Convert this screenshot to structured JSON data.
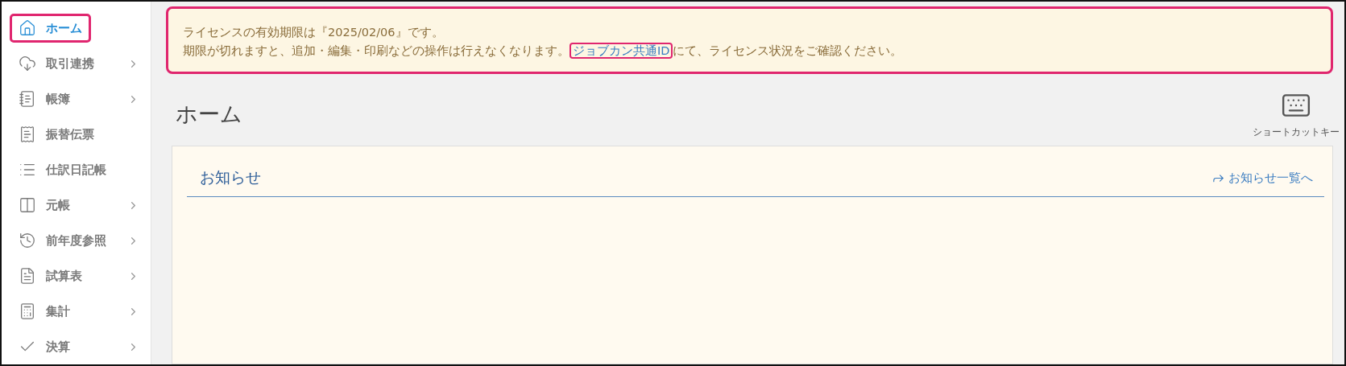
{
  "sidebar": {
    "items": [
      {
        "label": "ホーム",
        "kind": "home",
        "selected": true,
        "highlighted": true,
        "has_submenu": false
      },
      {
        "label": "取引連携",
        "kind": "cloud",
        "selected": false,
        "highlighted": false,
        "has_submenu": true
      },
      {
        "label": "帳簿",
        "kind": "book",
        "selected": false,
        "highlighted": false,
        "has_submenu": true
      },
      {
        "label": "振替伝票",
        "kind": "receipt",
        "selected": false,
        "highlighted": false,
        "has_submenu": false
      },
      {
        "label": "仕訳日記帳",
        "kind": "list",
        "selected": false,
        "highlighted": false,
        "has_submenu": false
      },
      {
        "label": "元帳",
        "kind": "columns",
        "selected": false,
        "highlighted": false,
        "has_submenu": true
      },
      {
        "label": "前年度参照",
        "kind": "history",
        "selected": false,
        "highlighted": false,
        "has_submenu": true
      },
      {
        "label": "試算表",
        "kind": "document",
        "selected": false,
        "highlighted": false,
        "has_submenu": true
      },
      {
        "label": "集計",
        "kind": "calculator",
        "selected": false,
        "highlighted": false,
        "has_submenu": true
      },
      {
        "label": "決算",
        "kind": "check",
        "selected": false,
        "highlighted": false,
        "has_submenu": true
      }
    ]
  },
  "banner": {
    "highlighted": true,
    "line_1": "ライセンスの有効期限は『2025/02/06』です。",
    "line_2_before": "期限が切れますと、追加・編集・印刷などの操作は行えなくなります。",
    "link": {
      "label": "ジョブカン共通ID",
      "highlighted": true
    },
    "line_2_after": "にて、ライセンス状況をご確認ください。"
  },
  "page_title": "ホーム",
  "shortcut_button": {
    "label": "ショートカットキー"
  },
  "notices": {
    "title": "お知らせ",
    "link": "お知らせ一覧へ"
  }
}
